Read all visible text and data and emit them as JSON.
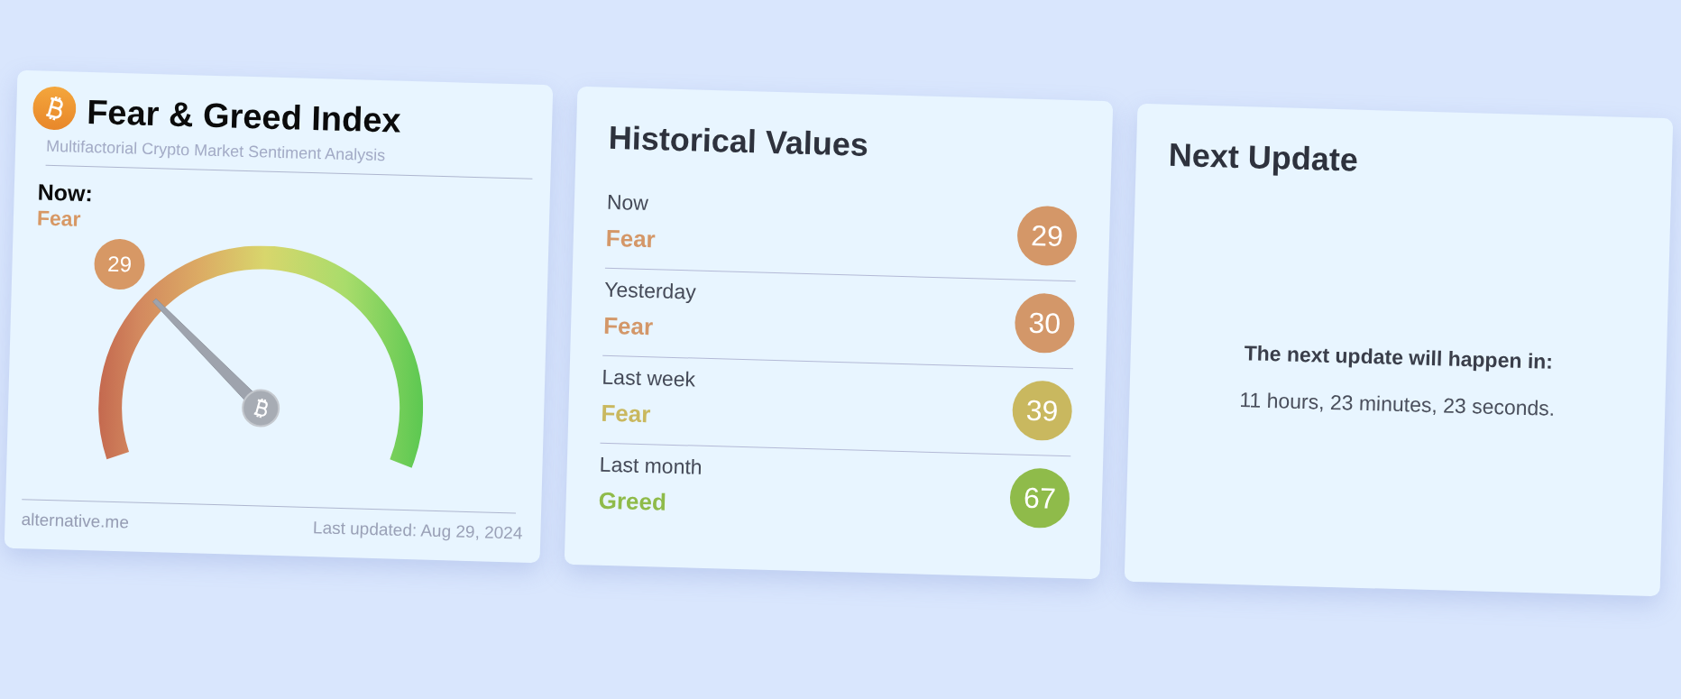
{
  "index_card": {
    "title": "Fear & Greed Index",
    "subtitle": "Multifactorial Crypto Market Sentiment Analysis",
    "now_label": "Now:",
    "now_classification": "Fear",
    "gauge": {
      "level": 0.29,
      "value": "29"
    },
    "source": "alternative.me",
    "last_updated": "Last updated: Aug 29, 2024"
  },
  "historical_card": {
    "title": "Historical Values",
    "rows": [
      {
        "period": "Now",
        "classification": "Fear",
        "value": "29",
        "color": "#d49768"
      },
      {
        "period": "Yesterday",
        "classification": "Fear",
        "value": "30",
        "color": "#d39769"
      },
      {
        "period": "Last week",
        "classification": "Fear",
        "value": "39",
        "color": "#c9b85f"
      },
      {
        "period": "Last month",
        "classification": "Greed",
        "value": "67",
        "color": "#8fbb4a"
      }
    ]
  },
  "next_update_card": {
    "title": "Next Update",
    "heading": "The next update will happen in:",
    "countdown": "11 hours, 23 minutes, 23 seconds."
  }
}
